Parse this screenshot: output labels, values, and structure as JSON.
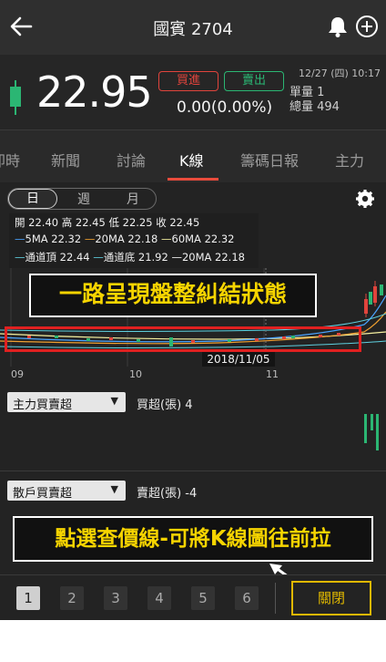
{
  "header": {
    "title": "國賓 2704",
    "back_icon": "arrow-left-icon",
    "bell_icon": "bell-icon",
    "add_icon": "plus-circle-icon"
  },
  "quote": {
    "price": "22.95",
    "buy_label": "買進",
    "sell_label": "賣出",
    "change": "0.00(0.00%)",
    "datetime": "12/27 (四) 10:17",
    "unit_volume": "單量 1",
    "total_volume": "總量 494",
    "colors": {
      "up": "#e0443c",
      "down": "#2bb673",
      "candle": "#2bb673"
    }
  },
  "tabs": [
    {
      "label": "即時",
      "active": false
    },
    {
      "label": "新聞",
      "active": false
    },
    {
      "label": "討論",
      "active": false
    },
    {
      "label": "K線",
      "active": true
    },
    {
      "label": "籌碼日報",
      "active": false
    },
    {
      "label": "主力",
      "active": false
    }
  ],
  "period": {
    "day": "日",
    "week": "週",
    "month": "月",
    "settings_icon": "gear-icon"
  },
  "indicators": {
    "ohlc": "開 22.40 高 22.45 低 22.25 收 22.45",
    "ma5": "5MA 22.32",
    "ma20": "20MA 22.18",
    "ma60": "60MA 22.32",
    "channel_top": "通道頂 22.44",
    "channel_bottom": "通道底 21.92",
    "channel_ma20": "20MA 22.18",
    "colors": {
      "ma5": "#4aa3ff",
      "ma20": "#f0a030",
      "ma60": "#f5f0a0",
      "channel": "#5fd0e0"
    }
  },
  "chart": {
    "x_ticks": [
      "09",
      "10",
      "11"
    ],
    "cursor_date": "2018/11/05"
  },
  "annotations": {
    "callout_top": "一路呈現盤整糾結狀態",
    "callout_bottom": "點選查價線-可將K線圖往前拉"
  },
  "panels": {
    "main_force": {
      "dropdown": "主力買賣超",
      "value": "買超(張) 4"
    },
    "retail": {
      "dropdown": "散戶買賣超",
      "value": "賣超(張) -4"
    }
  },
  "bottom": {
    "pages": [
      "1",
      "2",
      "3",
      "4",
      "5",
      "6"
    ],
    "active_page": "1",
    "close_label": "關閉"
  }
}
